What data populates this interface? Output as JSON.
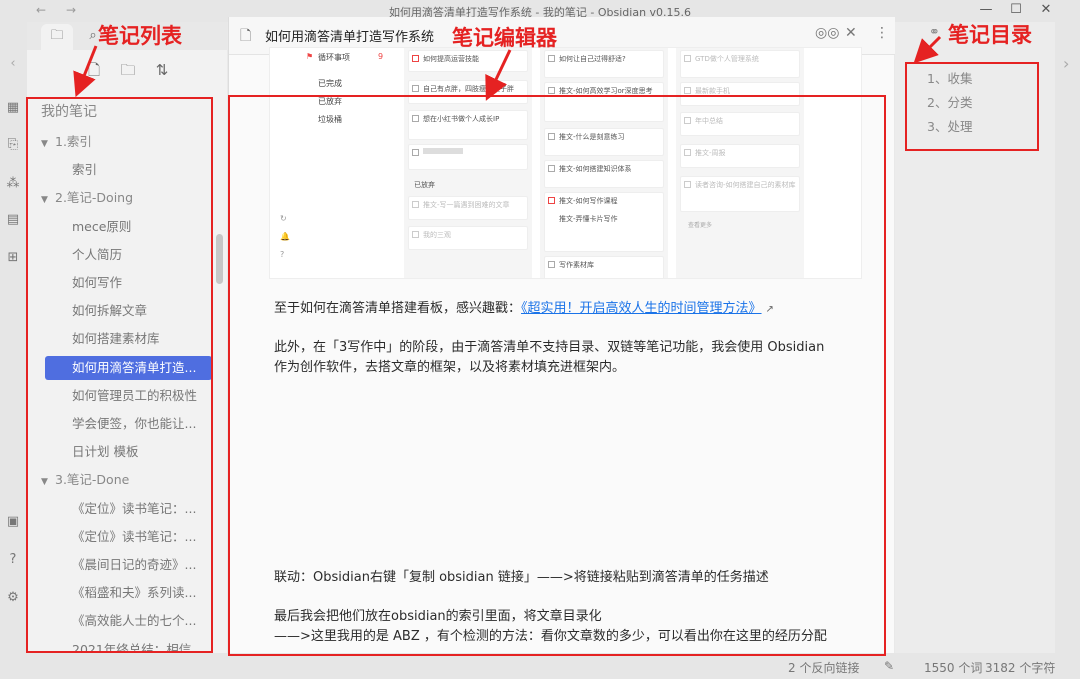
{
  "window": {
    "title": "如何用滴答清单打造写作系统 - 我的笔记 - Obsidian v0.15.6",
    "minimize": "—",
    "maximize": "☐",
    "close": "✕"
  },
  "annotations": {
    "left": "笔记列表",
    "center": "笔记编辑器",
    "right": "笔记目录",
    "color": "#e52222"
  },
  "sidebar": {
    "root": "我的笔记",
    "items": [
      {
        "label": "1.索引",
        "type": "folder"
      },
      {
        "label": "索引",
        "type": "file"
      },
      {
        "label": "2.笔记-Doing",
        "type": "folder"
      },
      {
        "label": "mece原则",
        "type": "file"
      },
      {
        "label": "个人简历",
        "type": "file"
      },
      {
        "label": "如何写作",
        "type": "file"
      },
      {
        "label": "如何拆解文章",
        "type": "file"
      },
      {
        "label": "如何搭建素材库",
        "type": "file"
      },
      {
        "label": "如何用滴答清单打造...",
        "type": "file",
        "active": true
      },
      {
        "label": "如何管理员工的积极性",
        "type": "file"
      },
      {
        "label": "学会便签，你也能让...",
        "type": "file"
      },
      {
        "label": "日计划 模板",
        "type": "file"
      },
      {
        "label": "3.笔记-Done",
        "type": "folder"
      },
      {
        "label": "《定位》读书笔记：...",
        "type": "file"
      },
      {
        "label": "《定位》读书笔记：...",
        "type": "file"
      },
      {
        "label": "《晨间日记的奇迹》...",
        "type": "file"
      },
      {
        "label": "《稻盛和夫》系列读...",
        "type": "file"
      },
      {
        "label": "《高效能人士的七个...",
        "type": "file"
      },
      {
        "label": "2021年终总结：相信...",
        "type": "file"
      }
    ],
    "accent": "#4f6ee0"
  },
  "editor": {
    "tab_title": "如何用滴答清单打造写作系统",
    "embed": {
      "nav": [
        "循环事项",
        "已完成",
        "已放弃",
        "垃圾桶"
      ],
      "nav_count": "9",
      "col1": [
        "如何提高运营技能",
        "自己有点胖，四肢瘦、肚子胖",
        "想在小红书做个人成长IP",
        "",
        "已放弃",
        "推文-写一篇遇到困难的文章",
        "我的三观"
      ],
      "col2": [
        "如何让自己过得舒适?",
        "推文-如何高效学习or深度思考",
        "推文-什么是刻意练习",
        "推文-如何搭建知识体系",
        "推文-如何写作课程",
        "推文-弄懂卡片写作",
        "写作素材库"
      ],
      "col3": [
        "GTD做个人管理系统",
        "最新款手机",
        "年中总结",
        "推文-周报",
        "读者咨询-如何搭建自己的素材库",
        "查看更多"
      ]
    },
    "p1_prefix": "至于如何在滴答清单搭建看板，感兴趣戳：",
    "p1_link": "《超实用！开启高效人生的时间管理方法》",
    "p2_line1": "此外，在「3写作中」的阶段，由于滴答清单不支持目录、双链等笔记功能，我会使用 Obsidian",
    "p2_line2": "作为创作软件，去搭文章的框架，以及将素材填充进框架内。",
    "p3": "联动：Obsidian右键「复制 obsidian 链接」——>将链接粘贴到滴答清单的任务描述",
    "p4_line1": "最后我会把他们放在obsidian的索引里面，将文章目录化",
    "p4_line2": "——>这里我用的是 ABZ ，有个检测的方法：看你文章数的多少，可以看出你在这里的经历分配"
  },
  "outline": {
    "items": [
      "1、收集",
      "2、分类",
      "3、处理"
    ]
  },
  "status": {
    "backlinks": "2 个反向链接",
    "words": "1550 个词",
    "chars": "3182 个字符"
  }
}
